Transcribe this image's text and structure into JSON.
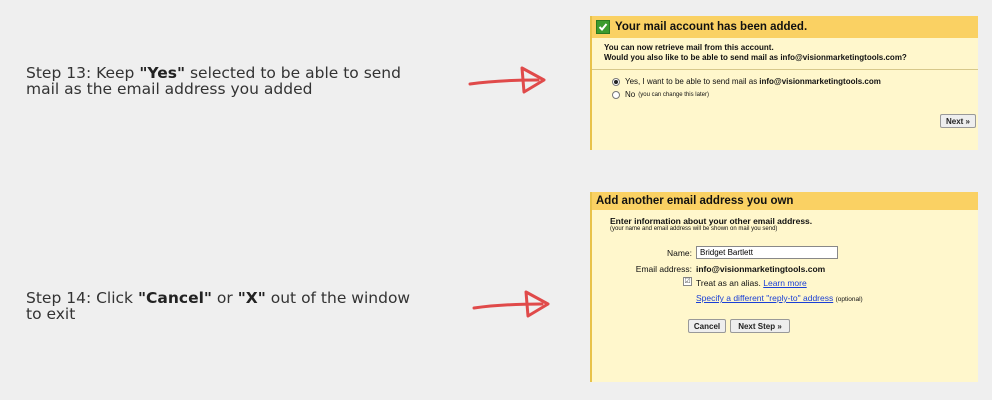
{
  "step13": {
    "prefix": "Step 13: Keep ",
    "bold": "\"Yes\"",
    "suffix": " selected to be able to send mail as the email address you added"
  },
  "step14": {
    "prefix": "Step 14: Click ",
    "bold1": "\"Cancel\"",
    "middle": " or ",
    "bold2": "\"X\"",
    "suffix": " out of the window to exit"
  },
  "colors": {
    "arrow": "#e04a4a",
    "header": "#fad163",
    "panel": "#fff7cc",
    "check": "#3c9b2e",
    "link": "#1a3fd6"
  },
  "panel1": {
    "title": "Your mail account has been added.",
    "line1": "You can now retrieve mail from this account.",
    "line2": "Would you also like to be able to send mail as info@visionmarketingtools.com?",
    "yes_label": "Yes, I want to be able to send mail as ",
    "yes_email": "info@visionmarketingtools.com",
    "no_label": "No",
    "no_note": "(you can change this later)",
    "next_button": "Next »"
  },
  "panel2": {
    "title": "Add another email address you own",
    "intro": "Enter information about your other email address.",
    "intro_sub": "(your name and email address will be shown on mail you send)",
    "name_label": "Name:",
    "name_value": "Bridget Bartlett",
    "email_label": "Email address:",
    "email_value": "info@visionmarketingtools.com",
    "alias_check": "☑",
    "alias_label": "Treat as an alias. ",
    "learn_more": "Learn more",
    "reply_to_link": "Specify a different \"reply-to\" address",
    "optional": "(optional)",
    "cancel_button": "Cancel",
    "next_step_button": "Next Step »"
  }
}
